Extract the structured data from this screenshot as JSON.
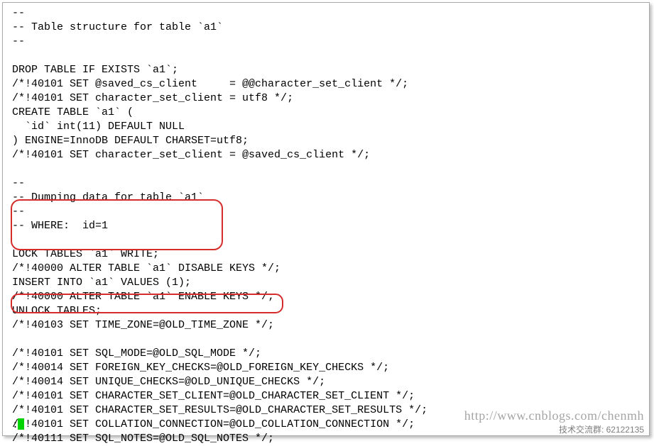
{
  "code": {
    "lines": [
      "--",
      "-- Table structure for table `a1`",
      "--",
      "",
      "DROP TABLE IF EXISTS `a1`;",
      "/*!40101 SET @saved_cs_client     = @@character_set_client */;",
      "/*!40101 SET character_set_client = utf8 */;",
      "CREATE TABLE `a1` (",
      "  `id` int(11) DEFAULT NULL",
      ") ENGINE=InnoDB DEFAULT CHARSET=utf8;",
      "/*!40101 SET character_set_client = @saved_cs_client */;",
      "",
      "--",
      "-- Dumping data for table `a1`",
      "--",
      "-- WHERE:  id=1",
      "",
      "LOCK TABLES `a1` WRITE;",
      "/*!40000 ALTER TABLE `a1` DISABLE KEYS */;",
      "INSERT INTO `a1` VALUES (1);",
      "/*!40000 ALTER TABLE `a1` ENABLE KEYS */;",
      "UNLOCK TABLES;",
      "/*!40103 SET TIME_ZONE=@OLD_TIME_ZONE */;",
      "",
      "/*!40101 SET SQL_MODE=@OLD_SQL_MODE */;",
      "/*!40014 SET FOREIGN_KEY_CHECKS=@OLD_FOREIGN_KEY_CHECKS */;",
      "/*!40014 SET UNIQUE_CHECKS=@OLD_UNIQUE_CHECKS */;",
      "/*!40101 SET CHARACTER_SET_CLIENT=@OLD_CHARACTER_SET_CLIENT */;",
      "/*!40101 SET CHARACTER_SET_RESULTS=@OLD_CHARACTER_SET_RESULTS */;",
      "/*!40101 SET COLLATION_CONNECTION=@OLD_COLLATION_CONNECTION */;",
      "/*!40111 SET SQL_NOTES=@OLD_SQL_NOTES */;"
    ]
  },
  "prompt": ":",
  "watermark": {
    "url": "http://www.cnblogs.com/chenmh",
    "qq": "技术交流群: 62122135"
  }
}
